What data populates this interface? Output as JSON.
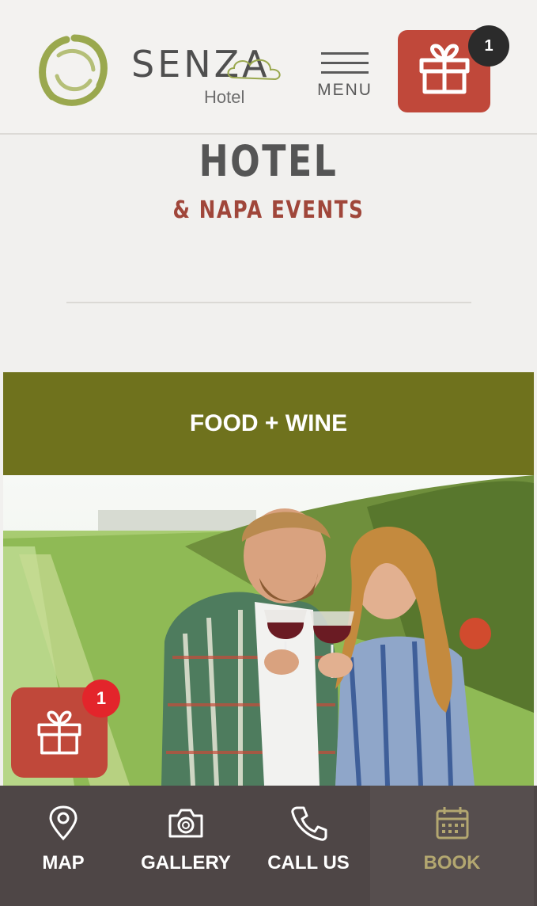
{
  "header": {
    "logo": {
      "name": "SENZA",
      "subtitle": "Hotel"
    },
    "menu_label": "MENU",
    "gift_badge": "1"
  },
  "hero": {
    "title": "HOTEL",
    "subtitle": "& NAPA EVENTS"
  },
  "category": {
    "label": "FOOD + WINE"
  },
  "floating_gift": {
    "badge": "1"
  },
  "bottom_nav": {
    "items": [
      {
        "label": "MAP",
        "icon": "map-pin-icon"
      },
      {
        "label": "GALLERY",
        "icon": "camera-icon"
      },
      {
        "label": "CALL US",
        "icon": "phone-icon"
      },
      {
        "label": "BOOK",
        "icon": "calendar-icon"
      }
    ]
  },
  "colors": {
    "page_bg": "#f1f0ee",
    "accent_red": "#c0483a",
    "olive_band": "#6f721d",
    "nav_bg": "#4e4646",
    "book_gold": "#b3a770",
    "logo_green": "#9aa84e"
  }
}
